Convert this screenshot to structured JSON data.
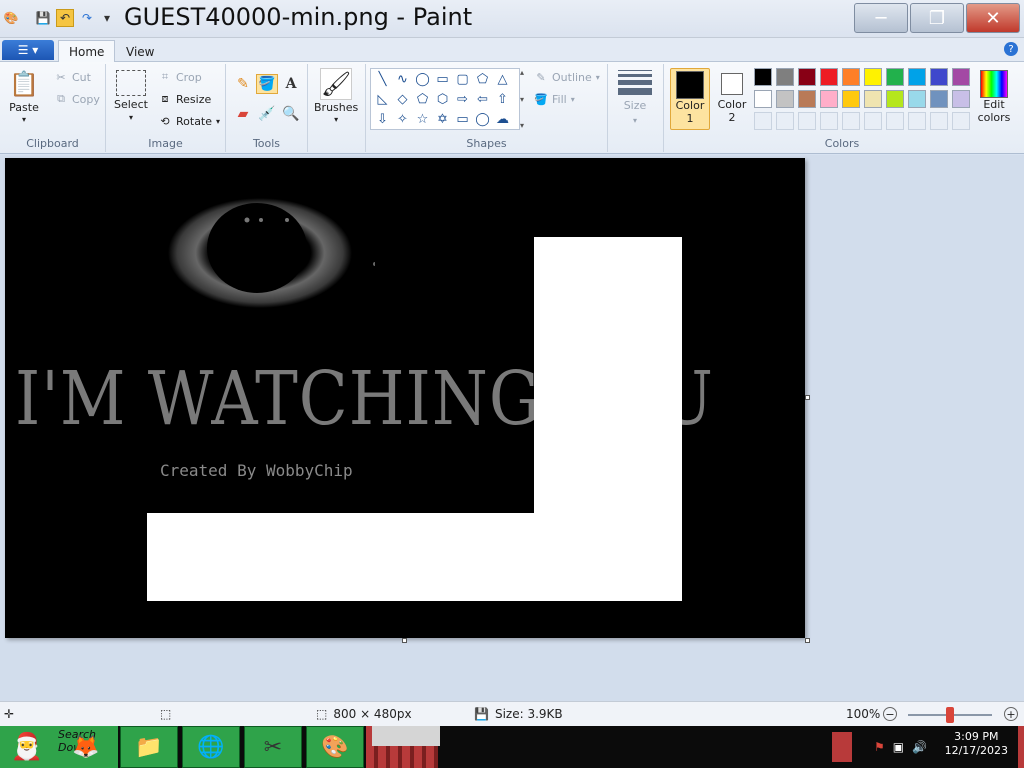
{
  "window": {
    "title": "GUEST40000-min.png - Paint"
  },
  "tabs": [
    {
      "label": "Home"
    },
    {
      "label": "View"
    }
  ],
  "ribbon": {
    "clipboard": {
      "label": "Clipboard",
      "paste": "Paste",
      "cut": "Cut",
      "copy": "Copy"
    },
    "image": {
      "label": "Image",
      "select": "Select",
      "crop": "Crop",
      "resize": "Resize",
      "rotate": "Rotate"
    },
    "tools": {
      "label": "Tools"
    },
    "brushes": {
      "label": "Brushes"
    },
    "shapes": {
      "label": "Shapes",
      "outline": "Outline",
      "fill": "Fill"
    },
    "size": {
      "label": "Size"
    },
    "colors": {
      "label": "Colors",
      "color1": "Color\n1",
      "color1_line1": "Color",
      "color1_line2": "1",
      "color2_line1": "Color",
      "color2_line2": "2",
      "edit_line1": "Edit",
      "edit_line2": "colors",
      "color1_value": "#000000",
      "color2_value": "#ffffff",
      "palette_row1": [
        "#000000",
        "#7f7f7f",
        "#880015",
        "#ed1c24",
        "#ff7f27",
        "#fff200",
        "#22b14c",
        "#00a2e8",
        "#3f48cc",
        "#a349a4"
      ],
      "palette_row2": [
        "#ffffff",
        "#c3c3c3",
        "#b97a57",
        "#ffaec9",
        "#ffc90e",
        "#efe4b0",
        "#b5e61d",
        "#99d9ea",
        "#7092be",
        "#c8bfe7"
      ]
    }
  },
  "image": {
    "main_text": "I'M WATCHING YOU",
    "credit_text": "Created By WobbyChip"
  },
  "status": {
    "dimensions": "800 × 480px",
    "size": "Size: 3.9KB",
    "zoom": "100%",
    "zoom_fraction": 0.5
  },
  "taskbar": {
    "search_text": "Search Dow",
    "time": "3:09 PM",
    "date": "12/17/2023"
  }
}
